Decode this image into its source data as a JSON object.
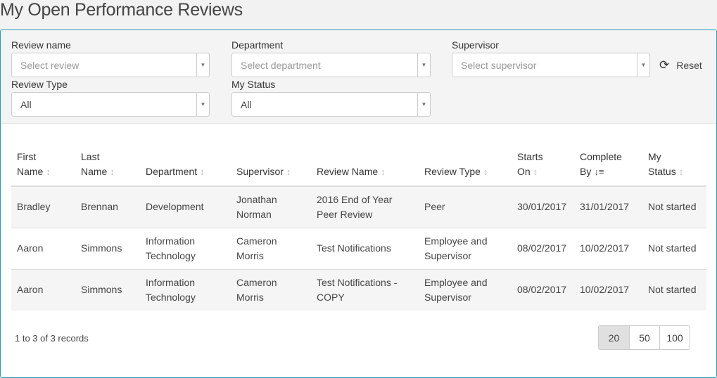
{
  "title": "My Open Performance Reviews",
  "filters": {
    "review_name": {
      "label": "Review name",
      "placeholder": "Select review"
    },
    "department": {
      "label": "Department",
      "placeholder": "Select department"
    },
    "supervisor": {
      "label": "Supervisor",
      "placeholder": "Select supervisor"
    },
    "review_type": {
      "label": "Review Type",
      "value": "All"
    },
    "my_status": {
      "label": "My Status",
      "value": "All"
    },
    "reset_label": "Reset"
  },
  "columns": [
    [
      "First",
      "Name"
    ],
    [
      "Last",
      "Name"
    ],
    [
      "",
      "Department"
    ],
    [
      "",
      "Supervisor"
    ],
    [
      "",
      "Review Name"
    ],
    [
      "",
      "Review Type"
    ],
    [
      "Starts",
      "On"
    ],
    [
      "Complete",
      "By"
    ],
    [
      "My",
      "Status"
    ]
  ],
  "rows": [
    [
      "Bradley",
      "Brennan",
      "Development",
      "Jonathan Norman",
      "2016 End of Year Peer Review",
      "Peer",
      "30/01/2017",
      "31/01/2017",
      "Not started"
    ],
    [
      "Aaron",
      "Simmons",
      "Information Technology",
      "Cameron Morris",
      "Test Notifications",
      "Employee and Supervisor",
      "08/02/2017",
      "10/02/2017",
      "Not started"
    ],
    [
      "Aaron",
      "Simmons",
      "Information Technology",
      "Cameron Morris",
      "Test Notifications - COPY",
      "Employee and Supervisor",
      "08/02/2017",
      "10/02/2017",
      "Not started"
    ]
  ],
  "record_count": "1 to 3 of 3 records",
  "page_sizes": [
    "20",
    "50",
    "100"
  ],
  "selected_page_size": "20",
  "sorted_column": "Complete By"
}
